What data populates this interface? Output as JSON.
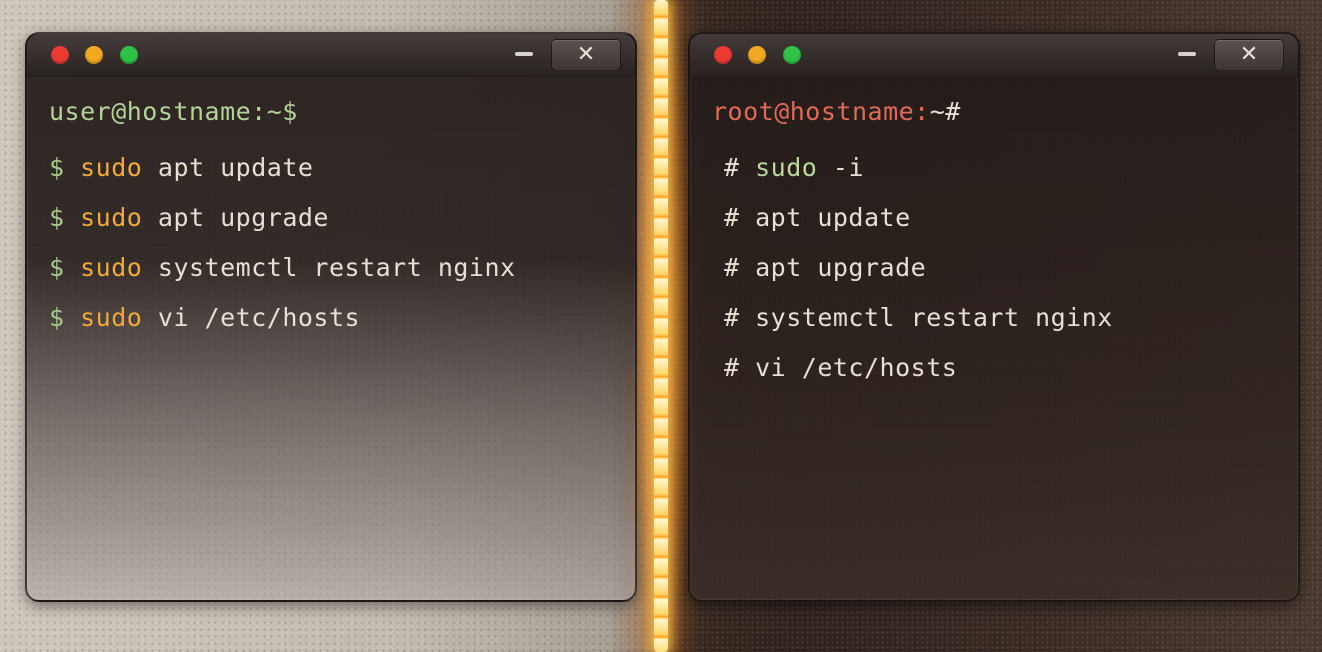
{
  "left_terminal": {
    "prompt": "user@hostname:~$",
    "prompt_symbol": "$",
    "commands": [
      {
        "prefix": "sudo",
        "rest": "apt update"
      },
      {
        "prefix": "sudo",
        "rest": "apt upgrade"
      },
      {
        "prefix": "sudo",
        "rest": "systemctl restart nginx"
      },
      {
        "prefix": "sudo",
        "rest": "vi /etc/hosts"
      }
    ]
  },
  "right_terminal": {
    "prompt_user": "root@hostname:",
    "prompt_end": "~#",
    "prompt_symbol": "#",
    "commands": [
      {
        "prefix": "sudo",
        "rest": "-i"
      },
      {
        "prefix": "",
        "rest": "apt update"
      },
      {
        "prefix": "",
        "rest": "apt upgrade"
      },
      {
        "prefix": "",
        "rest": "systemctl restart nginx"
      },
      {
        "prefix": "",
        "rest": "vi /etc/hosts"
      }
    ]
  },
  "window_controls": {
    "minimize_icon": "minimize-icon",
    "close_label": "✕"
  },
  "colors": {
    "left_prompt": "#b4d29a",
    "left_sudo": "#f1a93a",
    "right_prompt": "#e06a57",
    "seam_glow": "#ffb040",
    "traffic_red": "#ec3b33",
    "traffic_yellow": "#f2a922",
    "traffic_green": "#2fc346"
  }
}
